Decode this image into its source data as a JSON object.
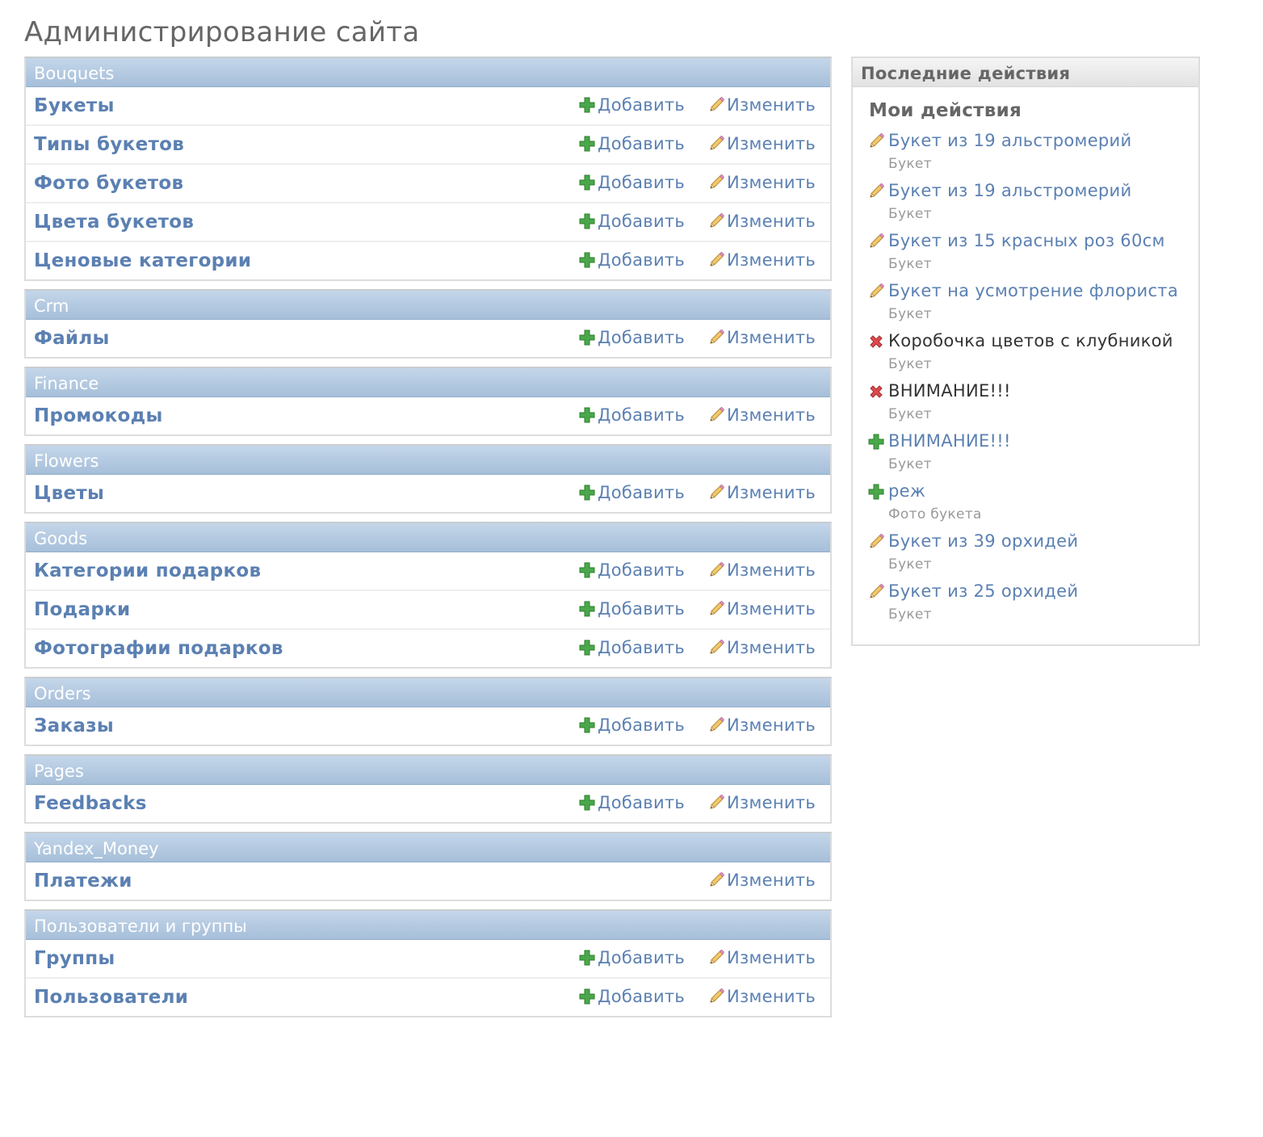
{
  "page_title": "Администрирование сайта",
  "labels": {
    "add": "Добавить",
    "change": "Изменить"
  },
  "colors": {
    "link": "#5b80b2",
    "module_header": "#a6bfd9",
    "add_icon": "#3e9a3b",
    "delete_icon": "#d94346"
  },
  "modules": [
    {
      "caption": "Bouquets",
      "models": [
        {
          "name": "Букеты",
          "has_add": true
        },
        {
          "name": "Типы букетов",
          "has_add": true
        },
        {
          "name": "Фото букетов",
          "has_add": true
        },
        {
          "name": "Цвета букетов",
          "has_add": true
        },
        {
          "name": "Ценовые категории",
          "has_add": true
        }
      ]
    },
    {
      "caption": "Crm",
      "models": [
        {
          "name": "Файлы",
          "has_add": true
        }
      ]
    },
    {
      "caption": "Finance",
      "models": [
        {
          "name": "Промокоды",
          "has_add": true
        }
      ]
    },
    {
      "caption": "Flowers",
      "models": [
        {
          "name": "Цветы",
          "has_add": true
        }
      ]
    },
    {
      "caption": "Goods",
      "models": [
        {
          "name": "Категории подарков",
          "has_add": true
        },
        {
          "name": "Подарки",
          "has_add": true
        },
        {
          "name": "Фотографии подарков",
          "has_add": true
        }
      ]
    },
    {
      "caption": "Orders",
      "models": [
        {
          "name": "Заказы",
          "has_add": true
        }
      ]
    },
    {
      "caption": "Pages",
      "models": [
        {
          "name": "Feedbacks",
          "has_add": true
        }
      ]
    },
    {
      "caption": "Yandex_Money",
      "models": [
        {
          "name": "Платежи",
          "has_add": false
        }
      ]
    },
    {
      "caption": "Пользователи и группы",
      "models": [
        {
          "name": "Группы",
          "has_add": true
        },
        {
          "name": "Пользователи",
          "has_add": true
        }
      ]
    }
  ],
  "recent_actions": {
    "caption": "Последние действия",
    "subtitle": "Мои действия",
    "items": [
      {
        "icon": "pencil-icon",
        "kind": "change",
        "title": "Букет из 19 альстромерий",
        "type": "Букет"
      },
      {
        "icon": "pencil-icon",
        "kind": "change",
        "title": "Букет из 19 альстромерий",
        "type": "Букет"
      },
      {
        "icon": "pencil-icon",
        "kind": "change",
        "title": "Букет из 15 красных роз 60см",
        "type": "Букет"
      },
      {
        "icon": "pencil-icon",
        "kind": "change",
        "title": "Букет на усмотрение флориста",
        "type": "Букет"
      },
      {
        "icon": "delete-icon",
        "kind": "delete",
        "title": "Коробочка цветов с клубникой",
        "type": "Букет"
      },
      {
        "icon": "delete-icon",
        "kind": "delete",
        "title": "ВНИМАНИЕ!!!",
        "type": "Букет"
      },
      {
        "icon": "plus-icon",
        "kind": "add",
        "title": "ВНИМАНИЕ!!!",
        "type": "Букет"
      },
      {
        "icon": "plus-icon",
        "kind": "add",
        "title": "реж",
        "type": "Фото букета"
      },
      {
        "icon": "pencil-icon",
        "kind": "change",
        "title": "Букет из 39 орхидей",
        "type": "Букет"
      },
      {
        "icon": "pencil-icon",
        "kind": "change",
        "title": "Букет из 25 орхидей",
        "type": "Букет"
      }
    ]
  }
}
